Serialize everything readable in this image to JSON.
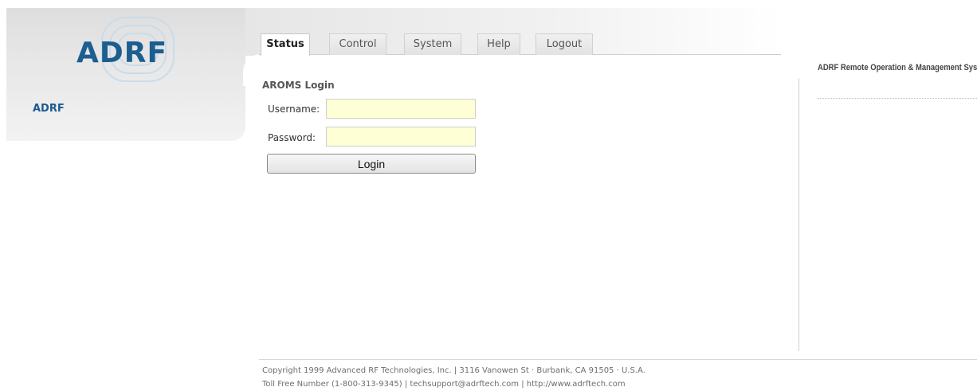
{
  "brand": {
    "logo_text": "ADRF",
    "site_name": "ADRF",
    "accent_color": "#1b5e8f"
  },
  "nav": {
    "tabs": [
      {
        "label": "Status",
        "active": true
      },
      {
        "label": "Control",
        "active": false
      },
      {
        "label": "System",
        "active": false
      },
      {
        "label": "Help",
        "active": false
      },
      {
        "label": "Logout",
        "active": false
      }
    ]
  },
  "login": {
    "title": "AROMS Login",
    "username_label": "Username:",
    "username_value": "",
    "password_label": "Password:",
    "password_value": "",
    "button_label": "Login",
    "input_bg_color": "#ffffd6"
  },
  "sidebar": {
    "title": "ADRF Remote Operation & Management System"
  },
  "footer": {
    "line1": "Copyright 1999 Advanced RF Technologies, Inc. | 3116 Vanowen St · Burbank, CA 91505 · U.S.A.",
    "line2": "Toll Free Number (1-800-313-9345) | techsupport@adrftech.com | http://www.adrftech.com"
  }
}
